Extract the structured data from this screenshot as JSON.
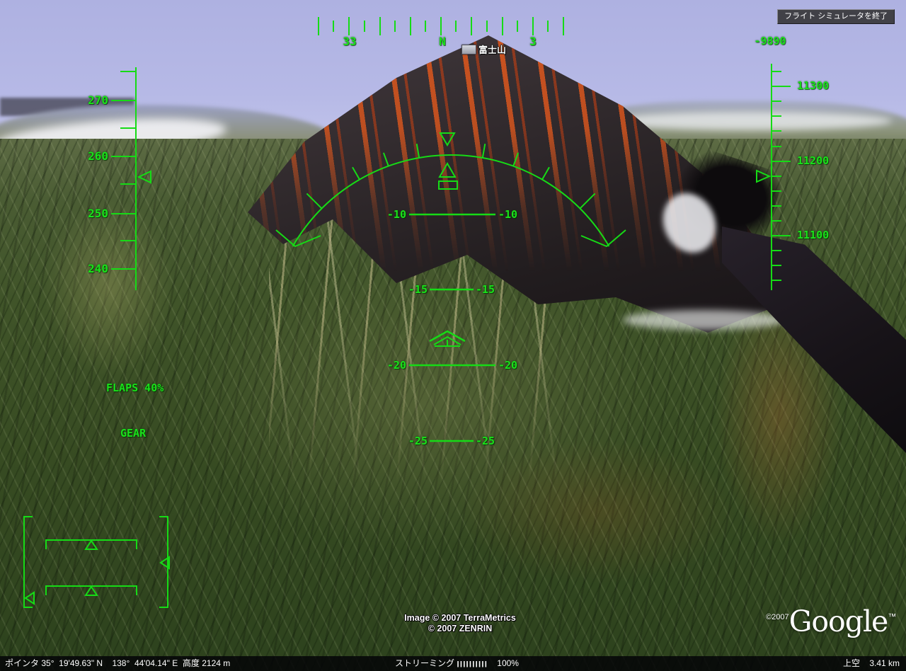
{
  "window": {
    "exit_button_label": "フライト シミュレータを終了"
  },
  "placemark": {
    "label": "富士山"
  },
  "hud": {
    "compass": {
      "labels": [
        "33",
        "N",
        "3"
      ]
    },
    "speed_tape": {
      "labels": [
        "270",
        "260",
        "250",
        "240"
      ]
    },
    "altitude_tape": {
      "top_value": "-9890",
      "labels": [
        "11300",
        "11200",
        "11100"
      ]
    },
    "pitch": {
      "lines": [
        "-10",
        "-15",
        "-20",
        "-25"
      ]
    },
    "flaps": "FLAPS 40%",
    "gear": "GEAR"
  },
  "attribution": {
    "line1": "Image © 2007 TerraMetrics",
    "line2": "© 2007 ZENRIN"
  },
  "google_logo": {
    "copyright": "©2007",
    "text": "Google",
    "tm": "™"
  },
  "status_bar": {
    "pointer_label": "ポインタ",
    "latitude": "35°  19'49.63\" N",
    "longitude": "138°  44'04.14\" E",
    "altitude_label": "高度",
    "altitude_value": "2124 m",
    "streaming_label": "ストリーミング",
    "streaming_bars": "||||||||||",
    "streaming_percent": "100%",
    "eye_altitude_label": "上空",
    "eye_altitude_value": "3.41 km"
  },
  "colors": {
    "hud_green": "#1be01b",
    "sky": "#b1b4e3",
    "status_bar_bg": "#040407"
  }
}
